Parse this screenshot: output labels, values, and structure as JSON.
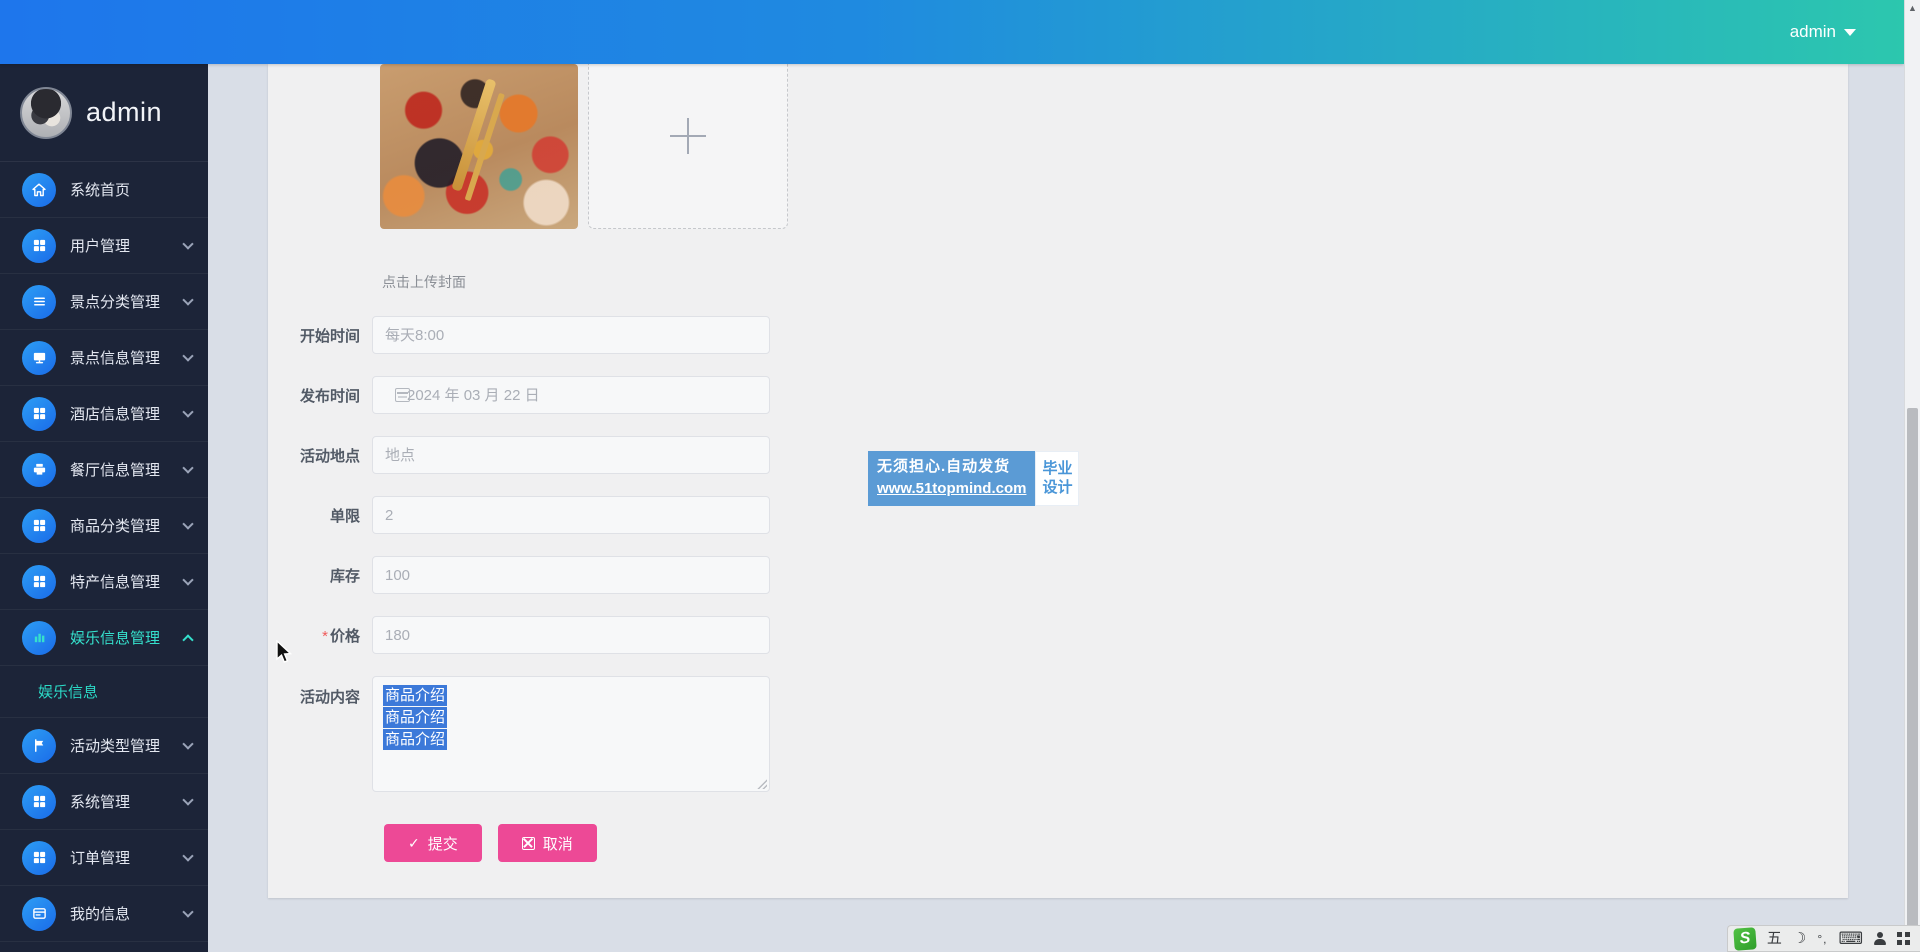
{
  "topbar": {
    "user_label": "admin"
  },
  "sidebar": {
    "username": "admin",
    "items": [
      {
        "label": "系统首页",
        "icon": "home-icon",
        "expandable": false
      },
      {
        "label": "用户管理",
        "icon": "grid-icon",
        "expandable": true
      },
      {
        "label": "景点分类管理",
        "icon": "list-icon",
        "expandable": true
      },
      {
        "label": "景点信息管理",
        "icon": "monitor-icon",
        "expandable": true
      },
      {
        "label": "酒店信息管理",
        "icon": "grid-icon",
        "expandable": true
      },
      {
        "label": "餐厅信息管理",
        "icon": "printer-icon",
        "expandable": true
      },
      {
        "label": "商品分类管理",
        "icon": "grid-icon",
        "expandable": true
      },
      {
        "label": "特产信息管理",
        "icon": "grid-icon",
        "expandable": true
      },
      {
        "label": "娱乐信息管理",
        "icon": "chart-icon",
        "expandable": true,
        "active": true,
        "expanded": true
      },
      {
        "label": "活动类型管理",
        "icon": "flag-icon",
        "expandable": true
      },
      {
        "label": "系统管理",
        "icon": "grid-icon",
        "expandable": true
      },
      {
        "label": "订单管理",
        "icon": "grid-icon",
        "expandable": true
      },
      {
        "label": "我的信息",
        "icon": "card-icon",
        "expandable": true
      }
    ],
    "submenu": {
      "parent": "娱乐信息管理",
      "label": "娱乐信息",
      "active": true
    }
  },
  "form": {
    "upload_hint": "点击上传封面",
    "fields": [
      {
        "label": "开始时间",
        "placeholder": "每天8:00"
      },
      {
        "label": "发布时间",
        "placeholder": "2024 年 03 月 22 日",
        "icon": "calendar-icon"
      },
      {
        "label": "活动地点",
        "placeholder": "地点"
      },
      {
        "label": "单限",
        "placeholder": "2"
      },
      {
        "label": "库存",
        "placeholder": "100"
      },
      {
        "label": "价格",
        "placeholder": "180",
        "required": true,
        "required_mark": "*"
      },
      {
        "label": "活动内容",
        "type": "textarea",
        "selected_lines": [
          "商品介绍",
          "商品介绍",
          "商品介绍"
        ]
      }
    ],
    "submit_label": "提交",
    "cancel_label": "取消"
  },
  "watermark": {
    "line1": "无须担心.自动发货",
    "line2": "www.51topmind.com",
    "badge_line1": "毕业",
    "badge_line2": "设计"
  },
  "ime_bar": {
    "engine": "sogou",
    "mode_label": "五",
    "icons": [
      "sogou-logo",
      "wubi-mode",
      "moon-icon",
      "punctuation-icon",
      "keyboard-icon",
      "person-icon",
      "grid-icon"
    ],
    "moon_glyph": "☽",
    "punct_glyph": "°,",
    "keyboard_glyph": "⌨"
  },
  "colors": {
    "topbar_gradient_left": "#1e76ec",
    "topbar_gradient_right": "#2cc7ae",
    "sidebar_bg": "#1c2438",
    "active_teal": "#35e0cc",
    "menu_icon_blue": "#1f7ff0",
    "button_pink": "#ed4996",
    "selection_blue": "#3c79d9",
    "watermark_blue": "#5b9bd5",
    "card_bg": "#f0f0f1",
    "page_bg": "#d9dee7"
  }
}
